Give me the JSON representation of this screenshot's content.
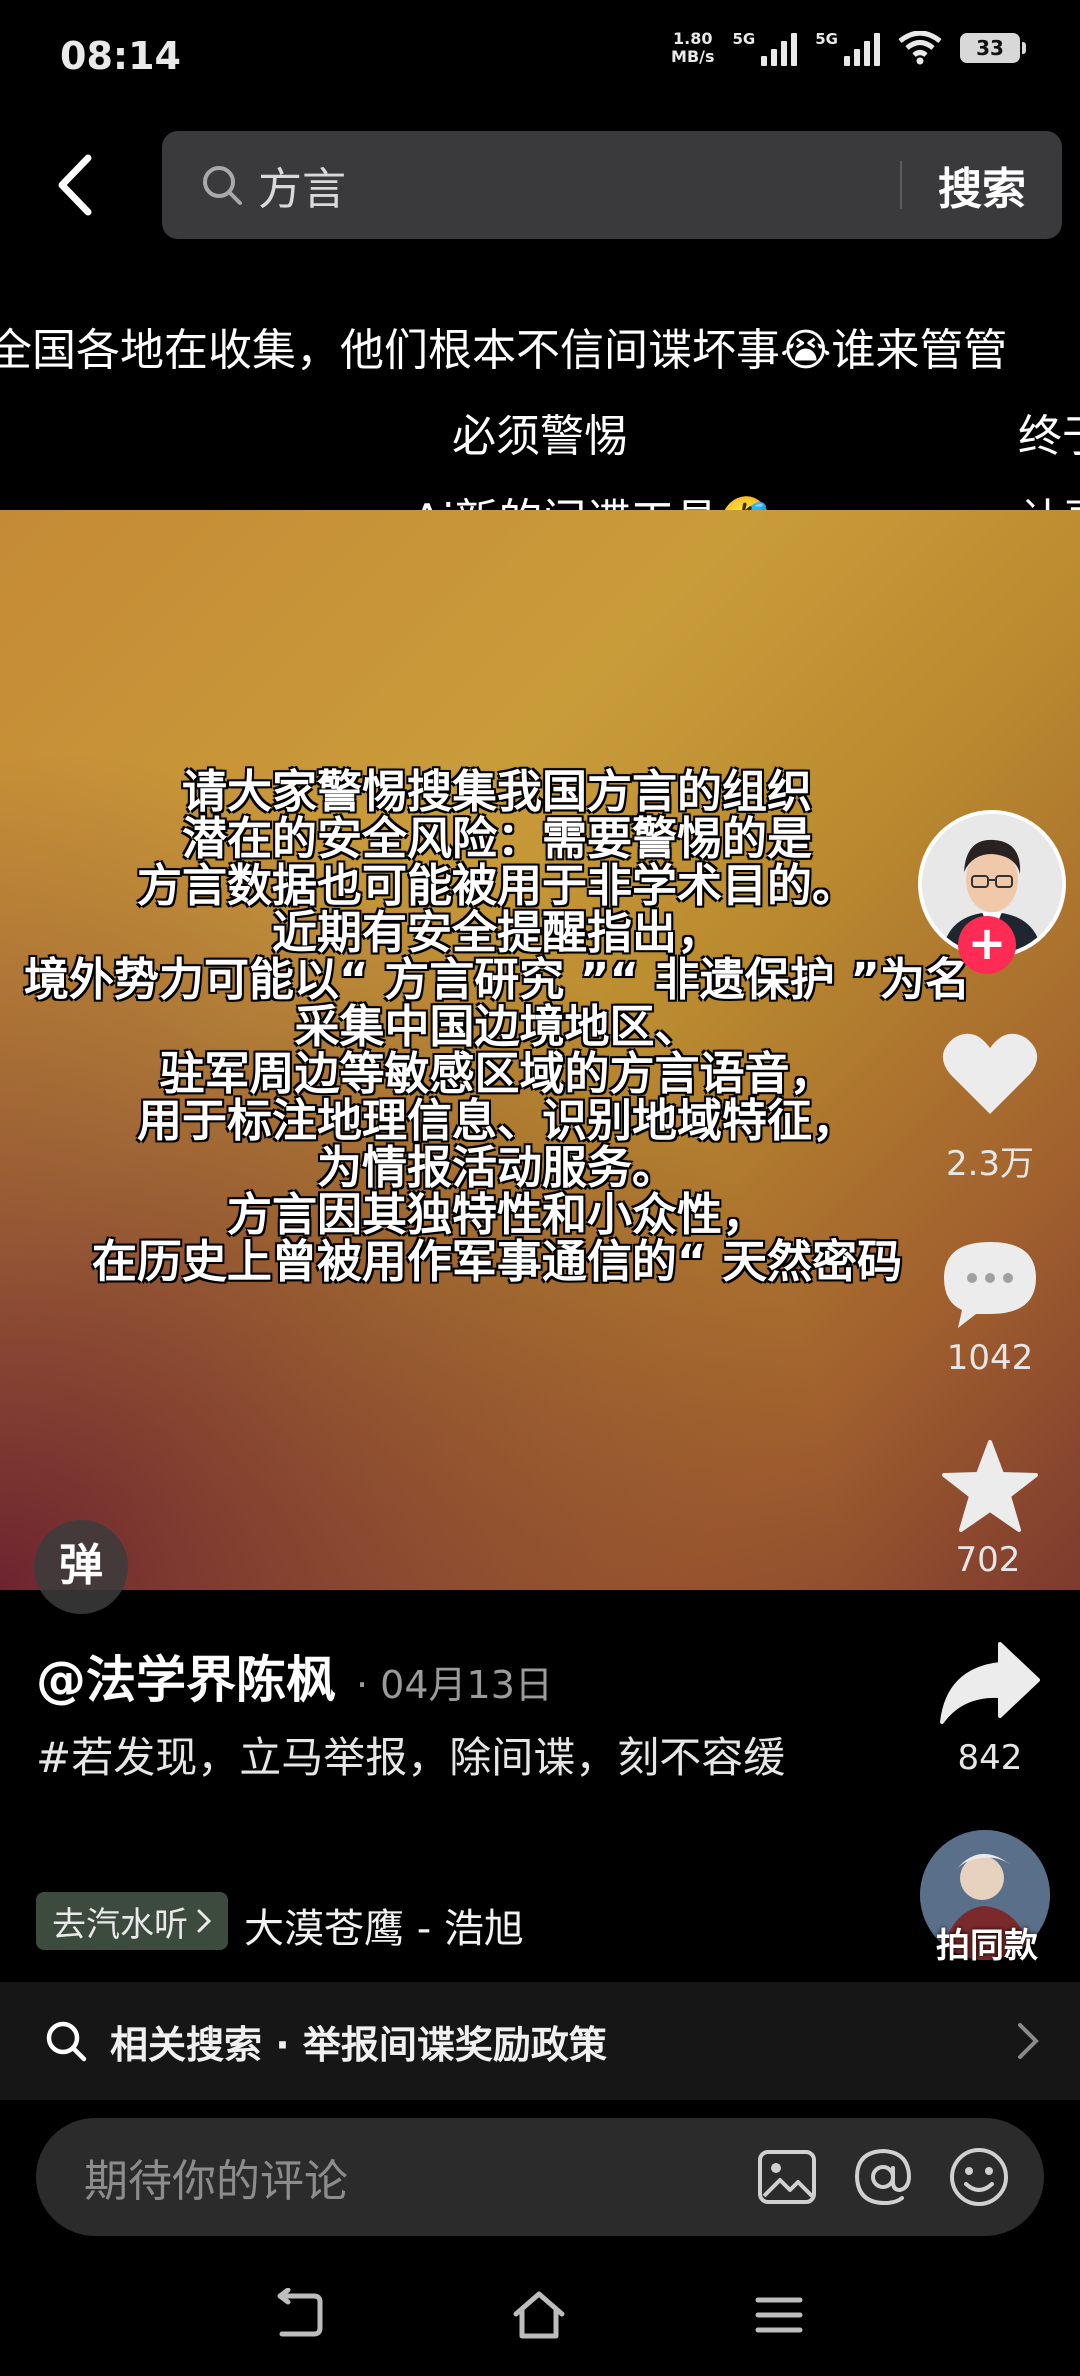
{
  "status_bar": {
    "time": "08:14",
    "speed_value": "1.80",
    "speed_unit": "MB/s",
    "sim1_label": "5G",
    "sim2_label": "5G",
    "battery": "33"
  },
  "search": {
    "query": "方言",
    "button_label": "搜索"
  },
  "danmaku": [
    "全国各地在收集，他们根本不信间谍坏事😭谁来管管",
    "必须警惕",
    "终于",
    "Ai新的间谍工具🤣",
    "让更"
  ],
  "video": {
    "overlay_lines": [
      "请大家警惕搜集我国方言的组织",
      "潜在的安全风险：需要警惕的是",
      "方言数据也可能被用于非学术目的。",
      "近期有安全提醒指出，",
      "境外势力可能以“ 方言研究 ”“ 非遗保护 ”为名",
      "采集中国边境地区、",
      "驻军周边等敏感区域的方言语音，",
      "用于标注地理信息、识别地域特征，",
      "为情报活动服务。",
      "方言因其独特性和小众性，",
      "在历史上曾被用作军事通信的“ 天然密码"
    ],
    "danmu_toggle_label": "弹"
  },
  "actions": {
    "likes": "2.3万",
    "comments": "1042",
    "favorites": "702",
    "shares": "842",
    "same_style_label": "拍同款"
  },
  "post": {
    "author": "@法学界陈枫",
    "date": "· 04月13日",
    "description": "#若发现，立马举报，除间谍，刻不容缓",
    "music_pill": "去汽水听",
    "music_name": "大漠苍鹰 - 浩旭"
  },
  "related_search": {
    "prefix": "相关搜索",
    "separator": "·",
    "query": "举报间谍奖励政策"
  },
  "comment_input": {
    "placeholder": "期待你的评论"
  },
  "colors": {
    "accent": "#fe2c55",
    "background": "#000000",
    "panel": "#161616"
  }
}
